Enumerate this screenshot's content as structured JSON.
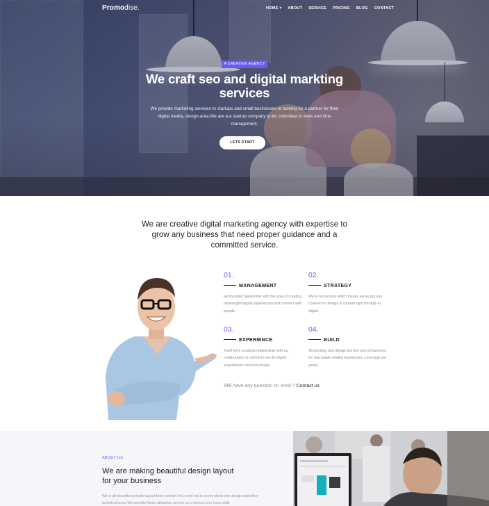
{
  "nav": {
    "logo_bold": "Promo",
    "logo_thin": "dise.",
    "items": [
      "HOME ▾",
      "ABOUT",
      "SERVICE",
      "PRICING",
      "BLOG",
      "CONTACT"
    ]
  },
  "hero": {
    "badge": "A CREATIVE AGENCY",
    "title": "We craft seo and digital markting services",
    "subtitle": "We provide marketing services to startups and small businesses to looking for a partner for their digital media, design-area.We are a a startup company to be commited to work and time management.",
    "button": "LETS START"
  },
  "intro": {
    "text": "We are creative digital marketing agency with expertise to grow any business that need proper guidance and a committed service."
  },
  "features": [
    {
      "num": "01.",
      "title": "MANAGEMENT",
      "desc": "we founded September with the goal of creating meaningful digital experiences that connect with people."
    },
    {
      "num": "02.",
      "title": "STRATEGY",
      "desc": "We're full service which means we've got you covered on design & content right through to digital."
    },
    {
      "num": "03.",
      "title": "EXPERIENCE",
      "desc": "You'll form a lasting relationship with us, collaboration is central to we do.Digital experiences connect people."
    },
    {
      "num": "04.",
      "title": "BUILD",
      "desc": "Technology and design are the core of business for real estate related businesses. Leverage our years."
    }
  ],
  "question": {
    "text": "Still have any question on mind ?",
    "link": "Contact us"
  },
  "about": {
    "tag": "ABOUT US",
    "title": "We are making beautiful design layout for your business",
    "paragraph": "We craft beautiful website layout from scretch.You need not to worry about site design and other technical issue.We provide these attractive service as a bonus.Let's have stalk"
  },
  "colors": {
    "accent": "#6a5cf2",
    "text": "#222222",
    "muted": "#888888"
  }
}
